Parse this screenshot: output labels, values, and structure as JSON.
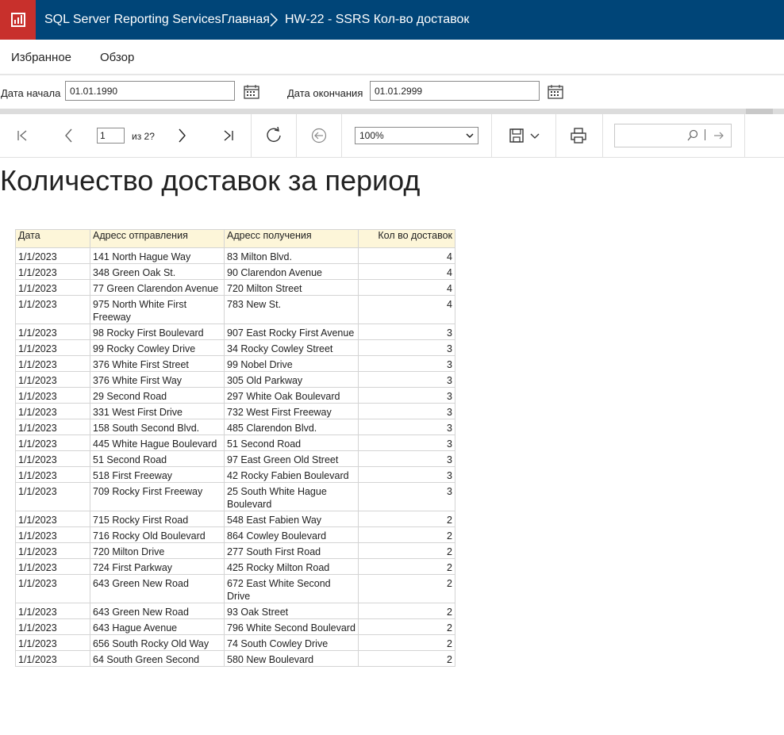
{
  "header": {
    "app_title": "SQL Server Reporting Services",
    "breadcrumb_home": "Главная",
    "breadcrumb_report": "HW-22 - SSRS Кол-во доставок"
  },
  "nav": {
    "favorites": "Избранное",
    "browse": "Обзор"
  },
  "params": {
    "start_label": "Дата начала",
    "start_value": "01.01.1990",
    "end_label": "Дата окончания",
    "end_value": "01.01.2999"
  },
  "toolbar": {
    "current_page": "1",
    "page_of": "из 2?",
    "zoom": "100%"
  },
  "report": {
    "title": "Количество доставок за период",
    "columns": [
      "Дата",
      "Адресс отправления",
      "Адресс получения",
      "Кол во доставок"
    ],
    "rows": [
      [
        "1/1/2023",
        "141 North Hague Way",
        "83 Milton Blvd.",
        "4"
      ],
      [
        "1/1/2023",
        "348 Green Oak St.",
        "90 Clarendon Avenue",
        "4"
      ],
      [
        "1/1/2023",
        "77 Green Clarendon Avenue",
        "720 Milton Street",
        "4"
      ],
      [
        "1/1/2023",
        "975 North White First Freeway",
        "783 New St.",
        "4"
      ],
      [
        "1/1/2023",
        "98 Rocky First Boulevard",
        "907 East Rocky First Avenue",
        "3"
      ],
      [
        "1/1/2023",
        "99 Rocky Cowley Drive",
        "34 Rocky Cowley Street",
        "3"
      ],
      [
        "1/1/2023",
        "376 White First Street",
        "99 Nobel Drive",
        "3"
      ],
      [
        "1/1/2023",
        "376 White First Way",
        "305 Old Parkway",
        "3"
      ],
      [
        "1/1/2023",
        "29 Second Road",
        "297 White Oak Boulevard",
        "3"
      ],
      [
        "1/1/2023",
        "331 West First Drive",
        "732 West First Freeway",
        "3"
      ],
      [
        "1/1/2023",
        "158 South Second Blvd.",
        "485 Clarendon Blvd.",
        "3"
      ],
      [
        "1/1/2023",
        "445 White Hague Boulevard",
        "51 Second Road",
        "3"
      ],
      [
        "1/1/2023",
        "51 Second Road",
        "97 East Green Old Street",
        "3"
      ],
      [
        "1/1/2023",
        "518 First Freeway",
        "42 Rocky Fabien Boulevard",
        "3"
      ],
      [
        "1/1/2023",
        "709 Rocky First Freeway",
        "25 South White Hague Boulevard",
        "3"
      ],
      [
        "1/1/2023",
        "715 Rocky First Road",
        "548 East Fabien Way",
        "2"
      ],
      [
        "1/1/2023",
        "716 Rocky Old Boulevard",
        "864 Cowley Boulevard",
        "2"
      ],
      [
        "1/1/2023",
        "720 Milton Drive",
        "277 South First Road",
        "2"
      ],
      [
        "1/1/2023",
        "724 First Parkway",
        "425 Rocky Milton Road",
        "2"
      ],
      [
        "1/1/2023",
        "643 Green New Road",
        "672 East White Second Drive",
        "2"
      ],
      [
        "1/1/2023",
        "643 Green New Road",
        "93 Oak Street",
        "2"
      ],
      [
        "1/1/2023",
        "643 Hague Avenue",
        "796 White Second Boulevard",
        "2"
      ],
      [
        "1/1/2023",
        "656 South Rocky Old Way",
        "74 South Cowley Drive",
        "2"
      ],
      [
        "1/1/2023",
        "64 South Green Second",
        "580 New Boulevard",
        "2"
      ]
    ]
  }
}
